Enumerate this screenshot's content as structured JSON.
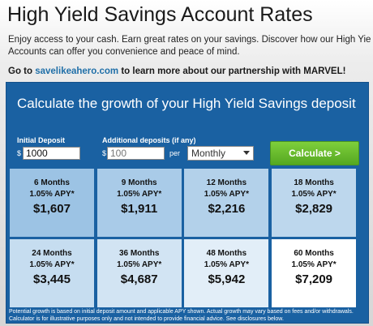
{
  "page": {
    "title": "High Yield Savings Account Rates",
    "intro_line1": "Enjoy access to your cash. Earn great rates on your savings. Discover how our High Yie",
    "intro_line2": "Accounts can offer you convenience and peace of mind.",
    "partner_prefix": "Go to ",
    "partner_link": "savelikeahero.com",
    "partner_suffix": " to learn more about our partnership with MARVEL!"
  },
  "calculator": {
    "title": "Calculate the growth of your High Yield Savings deposit",
    "initial_deposit_label": "Initial Deposit",
    "initial_deposit_value": "1000",
    "additional_label": "Additional deposits (if any)",
    "additional_placeholder": "100",
    "currency_symbol": "$",
    "per_label": "per",
    "frequency_selected": "Monthly",
    "button_label": "Calculate >",
    "results": [
      {
        "period": "6 Months",
        "apy": "1.05% APY*",
        "value": "$1,607",
        "color": "#9cc3e4"
      },
      {
        "period": "9 Months",
        "apy": "1.05% APY*",
        "value": "$1,911",
        "color": "#a9cbe8"
      },
      {
        "period": "12 Months",
        "apy": "1.05% APY*",
        "value": "$2,216",
        "color": "#b3d1ea"
      },
      {
        "period": "18 Months",
        "apy": "1.05% APY*",
        "value": "$2,829",
        "color": "#bdd7ed"
      },
      {
        "period": "24 Months",
        "apy": "1.05% APY*",
        "value": "$3,445",
        "color": "#c6ddf0"
      },
      {
        "period": "36 Months",
        "apy": "1.05% APY*",
        "value": "$4,687",
        "color": "#d2e4f3"
      },
      {
        "period": "48 Months",
        "apy": "1.05% APY*",
        "value": "$5,942",
        "color": "#e2eef8"
      },
      {
        "period": "60 Months",
        "apy": "1.05% APY*",
        "value": "$7,209",
        "color": "#ffffff"
      }
    ],
    "disclaimer": "Potential growth is based on initial deposit amount and applicable APY shown. Actual growth may vary based on fees and/or withdrawals. Calculator is for illustrative purposes only and not intended to provide financial advice. See disclosures below."
  }
}
